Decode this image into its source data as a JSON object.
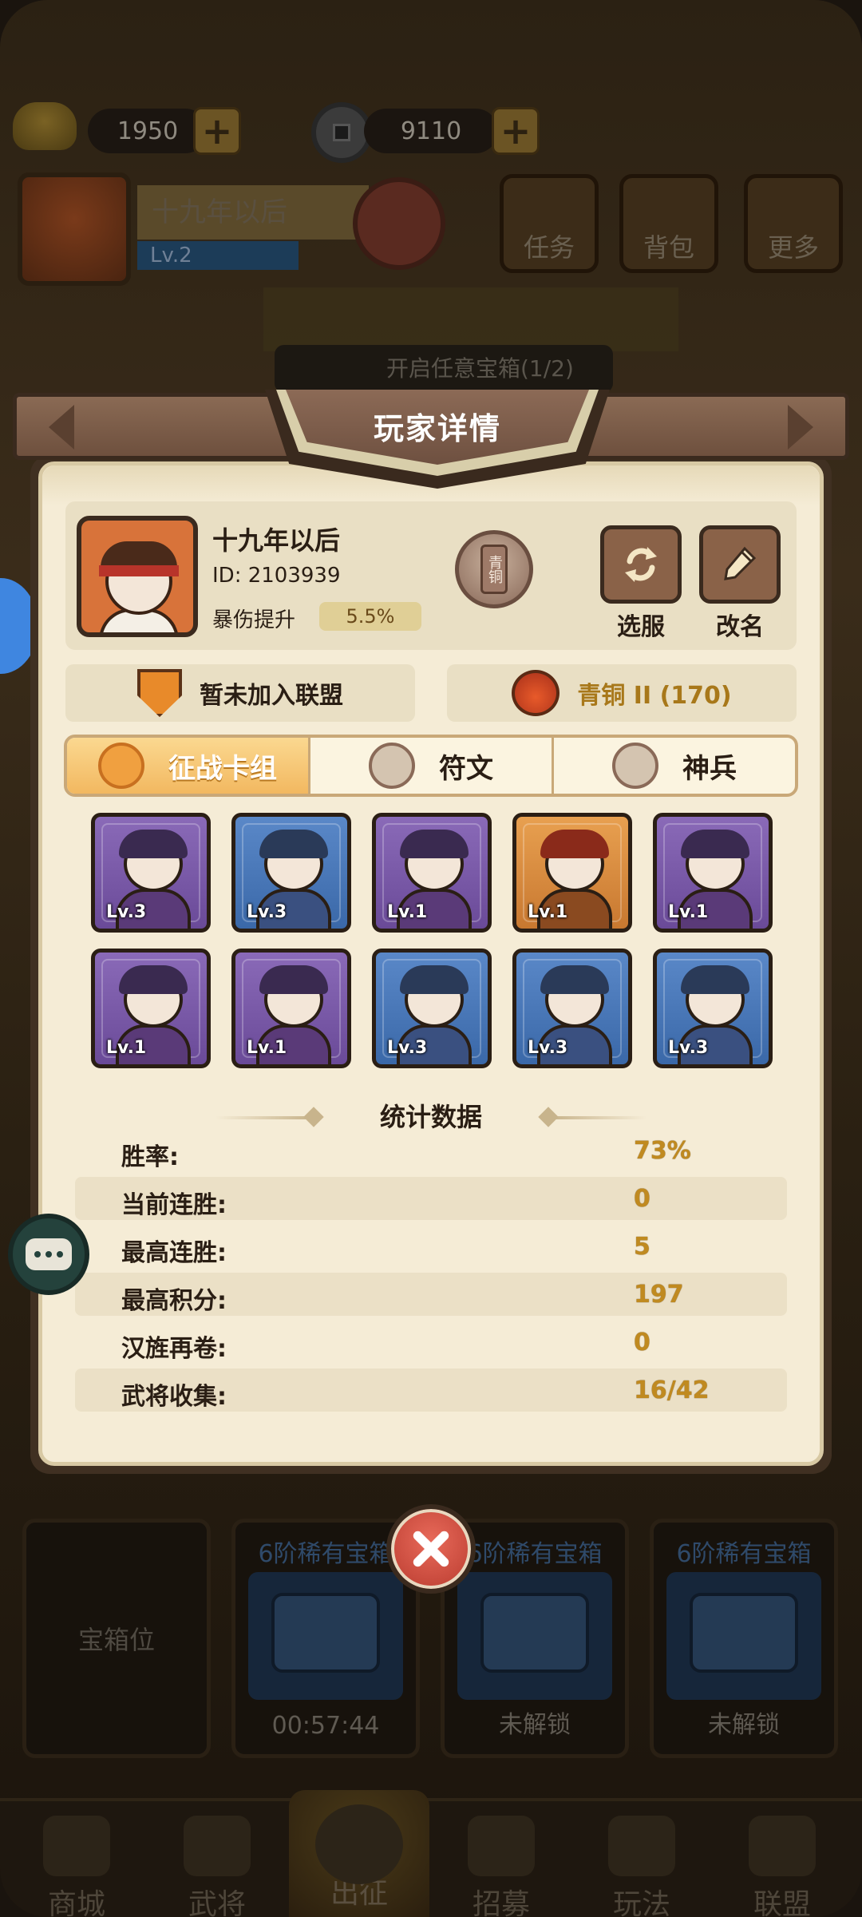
{
  "top_bar": {
    "gold": "1950",
    "coins": "9110"
  },
  "background_profile": {
    "name": "十九年以后",
    "level": "Lv.2",
    "buttons": [
      {
        "label": "任务"
      },
      {
        "label": "背包"
      },
      {
        "label": "更多"
      }
    ],
    "task_banner": "开启任意宝箱(1/2)"
  },
  "modal": {
    "title": "玩家详情",
    "player": {
      "name": "十九年以后",
      "id": "ID: 2103939",
      "crit_label": "暴伤提升",
      "crit_value": "5.5%",
      "rank_emblem_text": "青铜"
    },
    "actions": {
      "select_server": "选服",
      "rename": "改名"
    },
    "alliance": "暂未加入联盟",
    "rank": "青铜 II (170)",
    "tabs": [
      {
        "label": "征战卡组",
        "active": true
      },
      {
        "label": "符文",
        "active": false
      },
      {
        "label": "神兵",
        "active": false
      }
    ],
    "cards": [
      {
        "level": "Lv.3",
        "frame": "purple"
      },
      {
        "level": "Lv.3",
        "frame": "blue"
      },
      {
        "level": "Lv.1",
        "frame": "purple"
      },
      {
        "level": "Lv.1",
        "frame": "orange"
      },
      {
        "level": "Lv.1",
        "frame": "purple"
      },
      {
        "level": "Lv.1",
        "frame": "purple"
      },
      {
        "level": "Lv.1",
        "frame": "purple"
      },
      {
        "level": "Lv.3",
        "frame": "blue"
      },
      {
        "level": "Lv.3",
        "frame": "blue"
      },
      {
        "level": "Lv.3",
        "frame": "blue"
      }
    ],
    "stats_title": "统计数据",
    "stats": [
      {
        "label": "胜率:",
        "value": "73%"
      },
      {
        "label": "当前连胜:",
        "value": "0"
      },
      {
        "label": "最高连胜:",
        "value": "5"
      },
      {
        "label": "最高积分:",
        "value": "197"
      },
      {
        "label": "汉旌再卷:",
        "value": "0"
      },
      {
        "label": "武将收集:",
        "value": "16/42"
      }
    ]
  },
  "chests": {
    "slot_label": "宝箱位",
    "items": [
      {
        "title": "6阶稀有宝箱",
        "footer": "00:57:44"
      },
      {
        "title": "6阶稀有宝箱",
        "footer": "未解锁"
      },
      {
        "title": "6阶稀有宝箱",
        "footer": "未解锁"
      }
    ]
  },
  "bottom_nav": [
    {
      "label": "商城"
    },
    {
      "label": "武将"
    },
    {
      "label": "出征",
      "active": true
    },
    {
      "label": "招募"
    },
    {
      "label": "玩法"
    },
    {
      "label": "联盟"
    }
  ],
  "colors": {
    "panel_bg": "#f5ecd6",
    "frame_brown": "#3a2a1e",
    "tab_active": "#f2b860",
    "stat_value": "#c08a20",
    "close_red": "#b83a2e"
  }
}
